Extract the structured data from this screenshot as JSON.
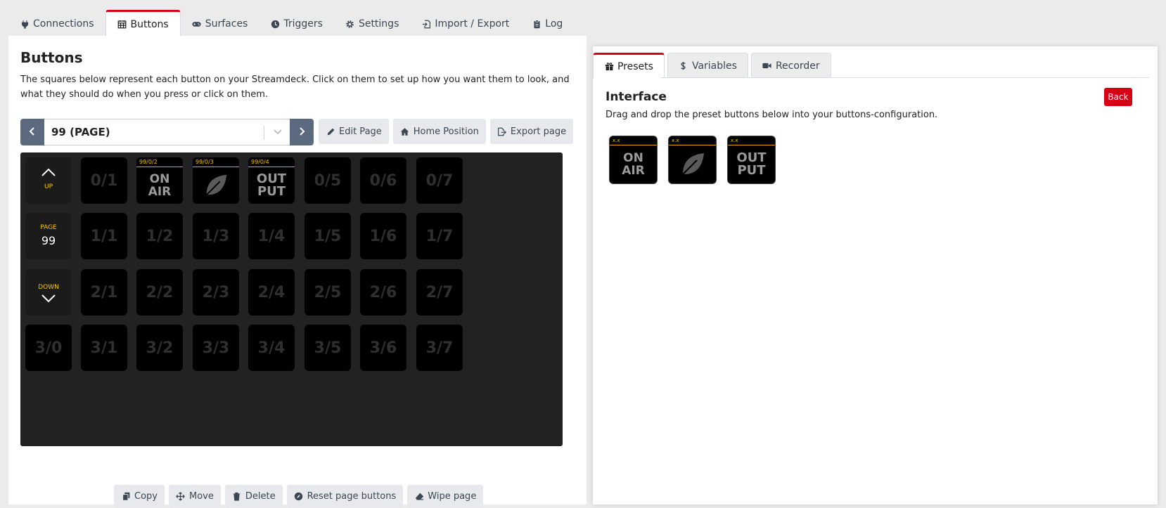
{
  "top_tabs": [
    {
      "label": "Connections",
      "icon": "plug-icon"
    },
    {
      "label": "Buttons",
      "icon": "calendar-grid-icon"
    },
    {
      "label": "Surfaces",
      "icon": "gamepad-icon"
    },
    {
      "label": "Triggers",
      "icon": "clock-icon"
    },
    {
      "label": "Settings",
      "icon": "gear-icon"
    },
    {
      "label": "Import / Export",
      "icon": "file-import-icon"
    },
    {
      "label": "Log",
      "icon": "clipboard-icon"
    }
  ],
  "buttons": {
    "title": "Buttons",
    "description": "The squares below represent each button on your Streamdeck. Click on them to set up how you want them to look, and what they should do when you press or click on them.",
    "page_select_value": "99 (PAGE)",
    "page_actions": [
      "Edit Page",
      "Home Position",
      "Export page"
    ],
    "grid": {
      "nav_up": "UP",
      "nav_page_label": "PAGE",
      "nav_page_number": "99",
      "nav_down": "DOWN",
      "keys": [
        {
          "id": "0/1",
          "label": "0/1"
        },
        {
          "id": "0/2",
          "header": "99/0/2",
          "text1": "ON",
          "text2": "AIR"
        },
        {
          "id": "0/3",
          "header": "99/0/3",
          "icon": "leaf-icon"
        },
        {
          "id": "0/4",
          "header": "99/0/4",
          "text1": "OUT",
          "text2": "PUT"
        },
        {
          "id": "0/5",
          "label": "0/5"
        },
        {
          "id": "0/6",
          "label": "0/6"
        },
        {
          "id": "0/7",
          "label": "0/7"
        },
        {
          "id": "1/1",
          "label": "1/1"
        },
        {
          "id": "1/2",
          "label": "1/2"
        },
        {
          "id": "1/3",
          "label": "1/3"
        },
        {
          "id": "1/4",
          "label": "1/4"
        },
        {
          "id": "1/5",
          "label": "1/5"
        },
        {
          "id": "1/6",
          "label": "1/6"
        },
        {
          "id": "1/7",
          "label": "1/7"
        },
        {
          "id": "2/1",
          "label": "2/1"
        },
        {
          "id": "2/2",
          "label": "2/2"
        },
        {
          "id": "2/3",
          "label": "2/3"
        },
        {
          "id": "2/4",
          "label": "2/4"
        },
        {
          "id": "2/5",
          "label": "2/5"
        },
        {
          "id": "2/6",
          "label": "2/6"
        },
        {
          "id": "2/7",
          "label": "2/7"
        },
        {
          "id": "3/0",
          "label": "3/0"
        },
        {
          "id": "3/1",
          "label": "3/1"
        },
        {
          "id": "3/2",
          "label": "3/2"
        },
        {
          "id": "3/3",
          "label": "3/3"
        },
        {
          "id": "3/4",
          "label": "3/4"
        },
        {
          "id": "3/5",
          "label": "3/5"
        },
        {
          "id": "3/6",
          "label": "3/6"
        },
        {
          "id": "3/7",
          "label": "3/7"
        }
      ]
    },
    "bottom_actions": [
      "Copy",
      "Move",
      "Delete",
      "Reset page buttons",
      "Wipe page"
    ]
  },
  "right": {
    "tabs": [
      "Presets",
      "Variables",
      "Recorder"
    ],
    "title": "Interface",
    "description": "Drag and drop the preset buttons below into your buttons-configuration.",
    "back_label": "Back",
    "presets": [
      {
        "header": "x.x",
        "text1": "ON",
        "text2": "AIR"
      },
      {
        "header": "x.x",
        "icon": "leaf-icon"
      },
      {
        "header": "x.x",
        "text1": "OUT",
        "text2": "PUT"
      }
    ]
  },
  "colors": {
    "accent": "#d50215",
    "nav": "#5b6a7f",
    "header_line": "#e9a000",
    "header_text": "#f4c400"
  }
}
